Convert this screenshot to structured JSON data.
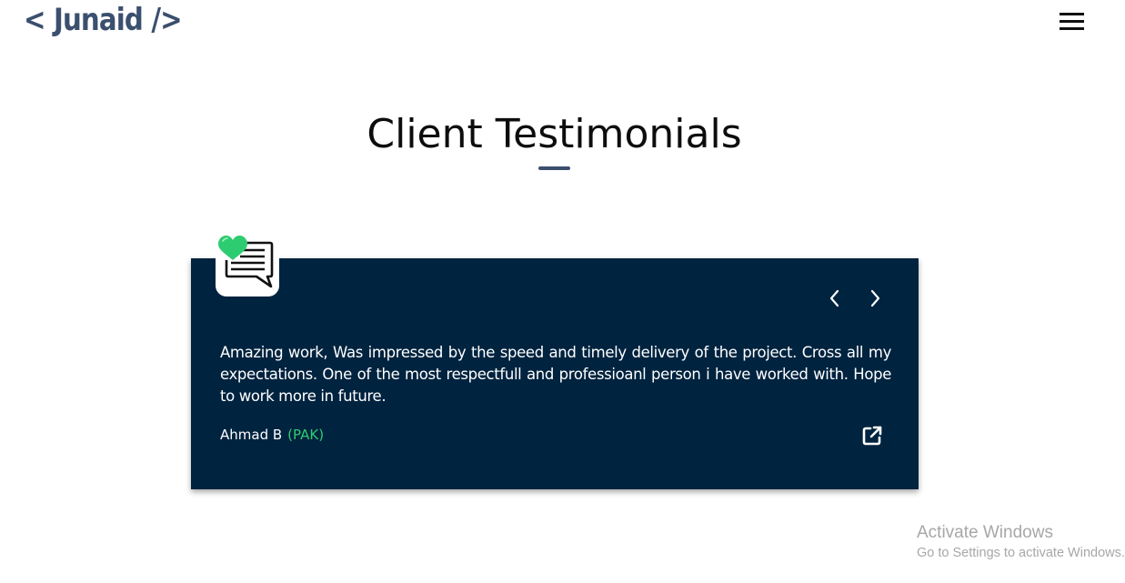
{
  "header": {
    "logo": "< Junaid />",
    "menu_icon": "hamburger-menu-icon"
  },
  "section": {
    "title": "Client Testimonials"
  },
  "testimonial": {
    "badge_icon": "heart-chat-icon",
    "prev_icon": "chevron-left-icon",
    "next_icon": "chevron-right-icon",
    "quote": "Amazing work, Was impressed by the speed and timely delivery of the project. Cross all my expectations. One of the most respectfull and professioanl person i have worked with. Hope to work more in future.",
    "client_name": "Ahmad B",
    "client_country": "(PAK)",
    "link_icon": "external-link-icon"
  },
  "watermark": {
    "title": "Activate Windows",
    "subtitle": "Go to Settings to activate Windows."
  },
  "colors": {
    "logo": "#3b4f6e",
    "card_bg": "#00233f",
    "accent_green": "#2ecc71",
    "underline": "#3b4f6e"
  }
}
